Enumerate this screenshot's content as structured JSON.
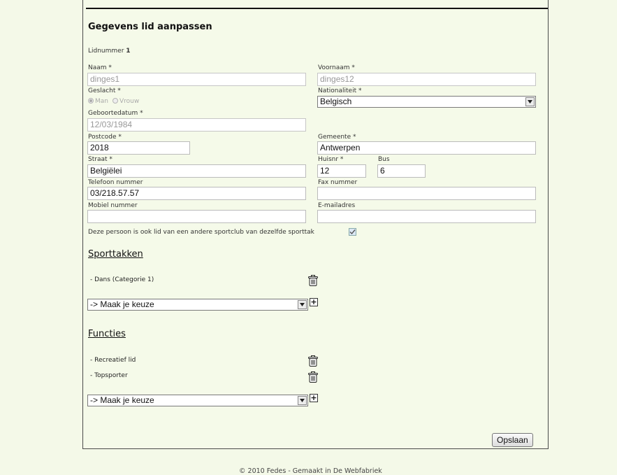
{
  "page": {
    "title": "Gegevens lid aanpassen"
  },
  "member": {
    "number_label": "Lidnummer",
    "number_value": "1"
  },
  "form": {
    "naam": {
      "label": "Naam *",
      "value": "dinges1"
    },
    "voornaam": {
      "label": "Voornaam *",
      "value": "dinges12"
    },
    "geslacht": {
      "label": "Geslacht *",
      "option_man": "Man",
      "option_vrouw": "Vrouw",
      "selected": "Man"
    },
    "nationaliteit": {
      "label": "Nationaliteit *",
      "value": "Belgisch"
    },
    "geboortedatum": {
      "label": "Geboortedatum *",
      "value": "12/03/1984"
    },
    "postcode": {
      "label": "Postcode *",
      "value": "2018"
    },
    "gemeente": {
      "label": "Gemeente *",
      "value": "Antwerpen"
    },
    "straat": {
      "label": "Straat *",
      "value": "Belgiëlei"
    },
    "huisnr": {
      "label": "Huisnr *",
      "value": "12"
    },
    "bus": {
      "label": "Bus",
      "value": "6"
    },
    "telefoon": {
      "label": "Telefoon nummer",
      "value": "03/218.57.57"
    },
    "fax": {
      "label": "Fax nummer",
      "value": ""
    },
    "mobiel": {
      "label": "Mobiel nummer",
      "value": ""
    },
    "email": {
      "label": "E-mailadres",
      "value": ""
    },
    "other_club": {
      "label": "Deze persoon is ook lid van een andere sportclub van dezelfde sporttak",
      "checked": true
    }
  },
  "sporttakken": {
    "heading": "Sporttakken",
    "items": [
      {
        "label": "- Dans (Categorie 1)"
      }
    ],
    "select_value": "-> Maak je keuze"
  },
  "functies": {
    "heading": "Functies",
    "items": [
      {
        "label": "- Recreatief lid"
      },
      {
        "label": "- Topsporter"
      }
    ],
    "select_value": "-> Maak je keuze"
  },
  "actions": {
    "save_label": "Opslaan"
  },
  "footer": {
    "text": "© 2010 Fedes - Gemaakt in De Webfabriek"
  },
  "icons": {
    "delete": "trash-icon",
    "add": "plus-icon",
    "dropdown": "chevron-down-icon"
  }
}
